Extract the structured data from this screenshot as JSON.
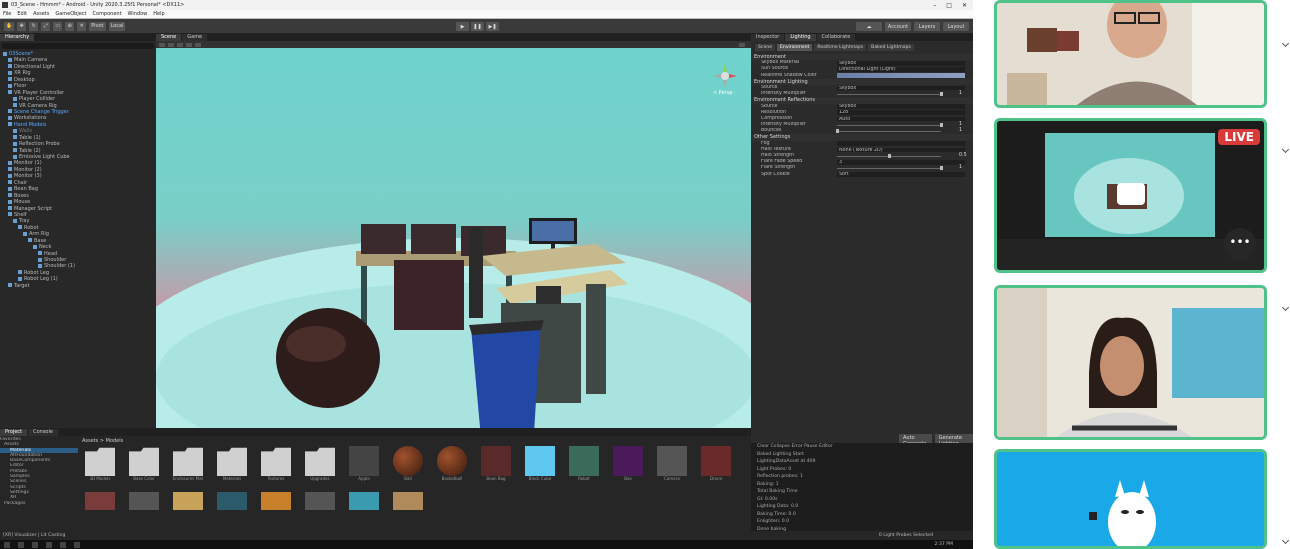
{
  "window": {
    "title": "03_Scene - Hmmm* - Android - Unity 2020.3.25f1 Personal* <DX11>"
  },
  "menu": [
    "File",
    "Edit",
    "Assets",
    "GameObject",
    "Component",
    "Window",
    "Help"
  ],
  "toolbar": {
    "pivot": "Pivot",
    "local": "Local",
    "account": "Account",
    "layers": "Layers",
    "layout": "Layout"
  },
  "hierarchy": {
    "tab": "Hierarchy",
    "rows": [
      {
        "label": "03Scene*",
        "indent": 0,
        "style": "blue"
      },
      {
        "label": "Main Camera",
        "indent": 1
      },
      {
        "label": "Directional Light",
        "indent": 1
      },
      {
        "label": "XR Rig",
        "indent": 1
      },
      {
        "label": "Desktop",
        "indent": 1
      },
      {
        "label": "Floor",
        "indent": 1
      },
      {
        "label": "VR Player Controller",
        "indent": 1
      },
      {
        "label": "Player Collider",
        "indent": 2
      },
      {
        "label": "VR Camera Rig",
        "indent": 2
      },
      {
        "label": "Scene Change Trigger",
        "indent": 1,
        "style": "blue"
      },
      {
        "label": "Workstations",
        "indent": 1
      },
      {
        "label": "Hand Models",
        "indent": 1,
        "style": "blue"
      },
      {
        "label": "Walls",
        "indent": 2,
        "style": "dim"
      },
      {
        "label": "Table (1)",
        "indent": 2
      },
      {
        "label": "Reflection Probe",
        "indent": 2
      },
      {
        "label": "Table (2)",
        "indent": 2
      },
      {
        "label": "Emissive Light Cube",
        "indent": 2
      },
      {
        "label": "Monitor (1)",
        "indent": 1
      },
      {
        "label": "Monitor (2)",
        "indent": 1
      },
      {
        "label": "Monitor (3)",
        "indent": 1
      },
      {
        "label": "Chair",
        "indent": 1
      },
      {
        "label": "Bean Bag",
        "indent": 1
      },
      {
        "label": "Boxes",
        "indent": 1
      },
      {
        "label": "Mouse",
        "indent": 1
      },
      {
        "label": "Manager Script",
        "indent": 1
      },
      {
        "label": "Shelf",
        "indent": 1
      },
      {
        "label": "Tray",
        "indent": 2
      },
      {
        "label": "Robot",
        "indent": 3
      },
      {
        "label": "Arm Rig",
        "indent": 4
      },
      {
        "label": "Base",
        "indent": 5
      },
      {
        "label": "Neck",
        "indent": 6
      },
      {
        "label": "Head",
        "indent": 7
      },
      {
        "label": "Shoulder",
        "indent": 7
      },
      {
        "label": "Shoulder (1)",
        "indent": 7
      },
      {
        "label": "Robot Leg",
        "indent": 3
      },
      {
        "label": "Robot Leg (1)",
        "indent": 3
      },
      {
        "label": "Target",
        "indent": 1
      }
    ]
  },
  "scene": {
    "tabs": [
      "Scene",
      "Game"
    ],
    "shading": "Shaded",
    "mode": "2D",
    "gizmos": "Gizmos",
    "gizmo_label": "< Persp"
  },
  "inspector": {
    "tabs": [
      "Inspector",
      "Lighting",
      "Collaborate"
    ],
    "subtabs": [
      "Scene",
      "Environment",
      "Realtime Lightmaps",
      "Baked Lightmaps"
    ],
    "environment_header": "Environment",
    "rows": [
      {
        "label": "Skybox Material",
        "value": "Skybox"
      },
      {
        "label": "Sun Source",
        "value": "Directional Light (Light)"
      },
      {
        "label": "Realtime Shadow Color",
        "value": ""
      }
    ],
    "env_lighting_header": "Environment Lighting",
    "env_lighting": [
      {
        "label": "Source",
        "value": "Skybox"
      },
      {
        "label": "Intensity Multiplier",
        "slider": 1,
        "text": "1"
      }
    ],
    "env_reflections_header": "Environment Reflections",
    "env_reflections": [
      {
        "label": "Source",
        "value": "Skybox"
      },
      {
        "label": "Resolution",
        "value": "128"
      },
      {
        "label": "Compression",
        "value": "Auto"
      },
      {
        "label": "Intensity Multiplier",
        "slider": 1,
        "text": "1"
      },
      {
        "label": "Bounces",
        "slider": 0,
        "text": "1"
      }
    ],
    "other_header": "Other Settings",
    "other": [
      {
        "label": "Fog",
        "value": ""
      },
      {
        "label": "Halo Texture",
        "value": "None (Texture 2D)"
      },
      {
        "label": "Halo Strength",
        "slider": 0.5,
        "text": "0.5"
      },
      {
        "label": "Flare Fade Speed",
        "value": "3"
      },
      {
        "label": "Flare Strength",
        "slider": 1,
        "text": "1"
      },
      {
        "label": "Spot Cookie",
        "value": "Soft"
      }
    ],
    "auto_generate": "Auto Generate",
    "generate_lighting": "Generate Lighting"
  },
  "project": {
    "tabs": [
      "Project",
      "Console"
    ],
    "favorites": "Favorites",
    "folders": [
      {
        "label": "Assets",
        "sel": false
      },
      {
        "label": "Materials",
        "sel": true
      },
      {
        "label": "ARFoundation",
        "sel": false
      },
      {
        "label": "BaseComponents",
        "sel": false
      },
      {
        "label": "Editor",
        "sel": false
      },
      {
        "label": "Prefabs",
        "sel": false
      },
      {
        "label": "Samples",
        "sel": false
      },
      {
        "label": "Scenes",
        "sel": false
      },
      {
        "label": "Scripts",
        "sel": false
      },
      {
        "label": "Settings",
        "sel": false
      },
      {
        "label": "XR",
        "sel": false
      },
      {
        "label": "Packages",
        "sel": false
      }
    ],
    "breadcrumb": "Assets > Models",
    "assets": [
      {
        "name": "3D Models",
        "kind": "folder"
      },
      {
        "name": "Base Color",
        "kind": "folder"
      },
      {
        "name": "Enclosures Mat",
        "kind": "folder"
      },
      {
        "name": "Materials",
        "kind": "folder"
      },
      {
        "name": "Textures",
        "kind": "folder"
      },
      {
        "name": "Upgrades",
        "kind": "folder"
      },
      {
        "name": "Apple",
        "kind": "dark"
      },
      {
        "name": "Ball",
        "kind": "sphere"
      },
      {
        "name": "Basketball",
        "kind": "sphere"
      },
      {
        "name": "Bean Bag",
        "kind": "bag"
      },
      {
        "name": "Block Cube",
        "kind": "cube"
      },
      {
        "name": "Robot",
        "kind": "robot"
      },
      {
        "name": "Box",
        "kind": "box"
      },
      {
        "name": "Camera",
        "kind": "plain"
      },
      {
        "name": "Drone",
        "kind": "drone"
      }
    ]
  },
  "console": {
    "header": "Clear  Collapse  Error Pause  Editor",
    "lines": [
      "Baked Lighting Start",
      "LightingDataAsset at 409",
      "Light Probes: 0",
      "Reflection probes: 1",
      "Baking: 1",
      "Total Baking Time",
      "GI: 0.00s",
      "Lighting Data: 0.0",
      "Baking Time: 0.0",
      "Enlighten: 0.0",
      "Done baking"
    ]
  },
  "status": {
    "text": "[XR] Visualizer | Lit Casting",
    "bake": "0 Light Probes Selected"
  },
  "taskbar": {
    "clock": "2:37 PM"
  },
  "video": {
    "live": "LIVE",
    "more": "•••"
  },
  "colors": {
    "accent": "#4fc28a",
    "live_red": "#d93b3b",
    "selected": "#2c5d87",
    "unity_bg": "#1e1e1e"
  }
}
